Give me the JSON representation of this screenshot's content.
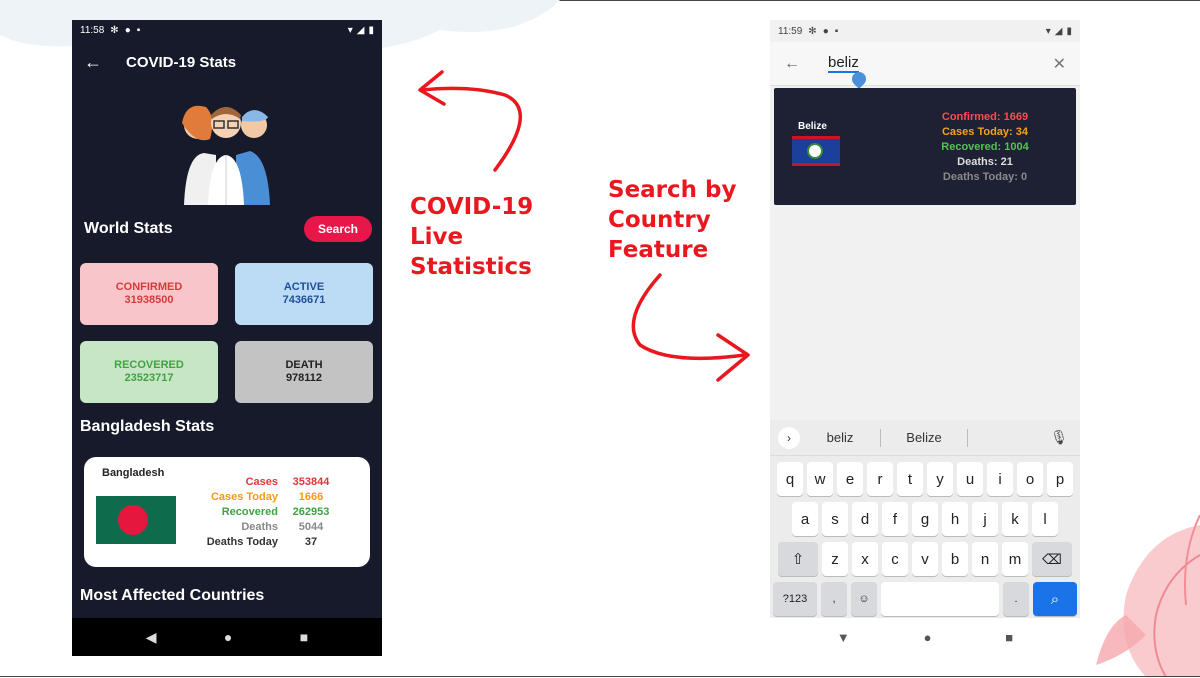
{
  "left_phone": {
    "status_time": "11:58",
    "app_title": "COVID-19 Stats",
    "world_stats_title": "World Stats",
    "search_label": "Search",
    "cards": {
      "confirmed_label": "CONFIRMED",
      "confirmed_value": "31938500",
      "active_label": "ACTIVE",
      "active_value": "7436671",
      "recovered_label": "RECOVERED",
      "recovered_value": "23523717",
      "death_label": "DEATH",
      "death_value": "978112"
    },
    "bangladesh_title": "Bangladesh Stats",
    "bangladesh_card": {
      "country": "Bangladesh",
      "rows": [
        {
          "label": "Cases",
          "value": "353844",
          "color": "#d83a3a"
        },
        {
          "label": "Cases Today",
          "value": "1666",
          "color": "#f29b11"
        },
        {
          "label": "Recovered",
          "value": "262953",
          "color": "#3fa33f"
        },
        {
          "label": "Deaths",
          "value": "5044",
          "color": "#888888"
        },
        {
          "label": "Deaths Today",
          "value": "37",
          "color": "#333333"
        }
      ]
    },
    "most_affected_title": "Most Affected Countries"
  },
  "annotations": {
    "left_lines": [
      "COVID-19",
      "Live",
      "Statistics"
    ],
    "right_lines": [
      "Search by",
      "Country",
      "Feature"
    ],
    "color": "#e8181e"
  },
  "right_phone": {
    "status_time": "11:59",
    "search_query": "beliz",
    "result": {
      "country": "Belize",
      "confirmed": "Confirmed: 1669",
      "cases_today": "Cases Today: 34",
      "recovered": "Recovered: 1004",
      "deaths": "Deaths: 21",
      "deaths_today": "Deaths Today: 0"
    },
    "keyboard": {
      "suggestions": [
        "beliz",
        "Belize"
      ],
      "row1": [
        "q",
        "w",
        "e",
        "r",
        "t",
        "y",
        "u",
        "i",
        "o",
        "p"
      ],
      "row2": [
        "a",
        "s",
        "d",
        "f",
        "g",
        "h",
        "j",
        "k",
        "l"
      ],
      "row3": [
        "z",
        "x",
        "c",
        "v",
        "b",
        "n",
        "m"
      ],
      "symbols_key": "?123",
      "comma_key": ",",
      "period_key": "."
    }
  }
}
